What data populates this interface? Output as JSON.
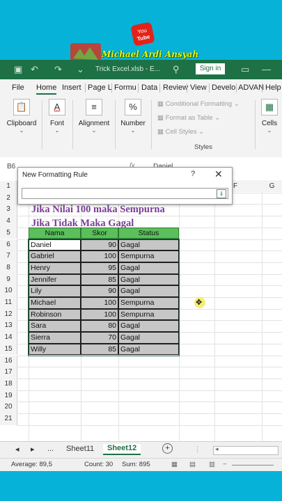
{
  "brand": {
    "channel": "Michael Ardi Ansyah",
    "yt_text": "You Tube"
  },
  "titlebar": {
    "file_name": "Trick Excel.xlsb - E...",
    "sign_in": "Sign in"
  },
  "tabs": [
    "File",
    "Home",
    "Insert",
    "Page L",
    "Formu",
    "Data",
    "Review",
    "View",
    "Develo",
    "ADVAN",
    "Help"
  ],
  "active_tab": "Home",
  "ribbon": {
    "clipboard": "Clipboard",
    "font": "Font",
    "alignment": "Alignment",
    "number": "Number",
    "number_symbol": "%",
    "conditional_formatting": "Conditional Formatting",
    "format_as_table": "Format as Table",
    "cell_styles": "Cell Styles",
    "styles": "Styles",
    "cells": "Cells"
  },
  "formula_bar": {
    "name_box": "B6",
    "value": "Daniel",
    "fx": "fx"
  },
  "dialog": {
    "title": "New Formatting Rule",
    "help": "?",
    "close": "✕"
  },
  "columns": [
    "F",
    "G"
  ],
  "rows": [
    "1",
    "2",
    "3",
    "4",
    "5",
    "6",
    "7",
    "8",
    "9",
    "10",
    "11",
    "12",
    "13",
    "14",
    "15",
    "16",
    "17",
    "18",
    "19",
    "20",
    "21"
  ],
  "titles": {
    "line1": "Jika Nilai 100 maka Sempurna",
    "line2": "Jika Tidak Maka Gagal"
  },
  "table": {
    "headers": [
      "Nama",
      "Skor",
      "Status"
    ],
    "rows": [
      [
        "Daniel",
        "90",
        "Gagal"
      ],
      [
        "Gabriel",
        "100",
        "Sempurna"
      ],
      [
        "Henry",
        "95",
        "Gagal"
      ],
      [
        "Jennifer",
        "85",
        "Gagal"
      ],
      [
        "Lily",
        "90",
        "Gagal"
      ],
      [
        "Michael",
        "100",
        "Sempurna"
      ],
      [
        "Robinson",
        "100",
        "Sempurna"
      ],
      [
        "Sara",
        "80",
        "Gagal"
      ],
      [
        "Sierra",
        "70",
        "Gagal"
      ],
      [
        "Willy",
        "85",
        "Gagal"
      ]
    ]
  },
  "sheets": {
    "more": "...",
    "sheet11": "Sheet11",
    "sheet12": "Sheet12",
    "add": "+"
  },
  "status": {
    "average": "Average: 89,5",
    "count": "Count: 30",
    "sum": "Sum: 895"
  },
  "colors": {
    "excel_green": "#1d7145",
    "header_fill": "#5cbf5c",
    "data_fill": "#c6c6c6",
    "title_purple": "#7a3d94",
    "background": "#07b2d9"
  }
}
